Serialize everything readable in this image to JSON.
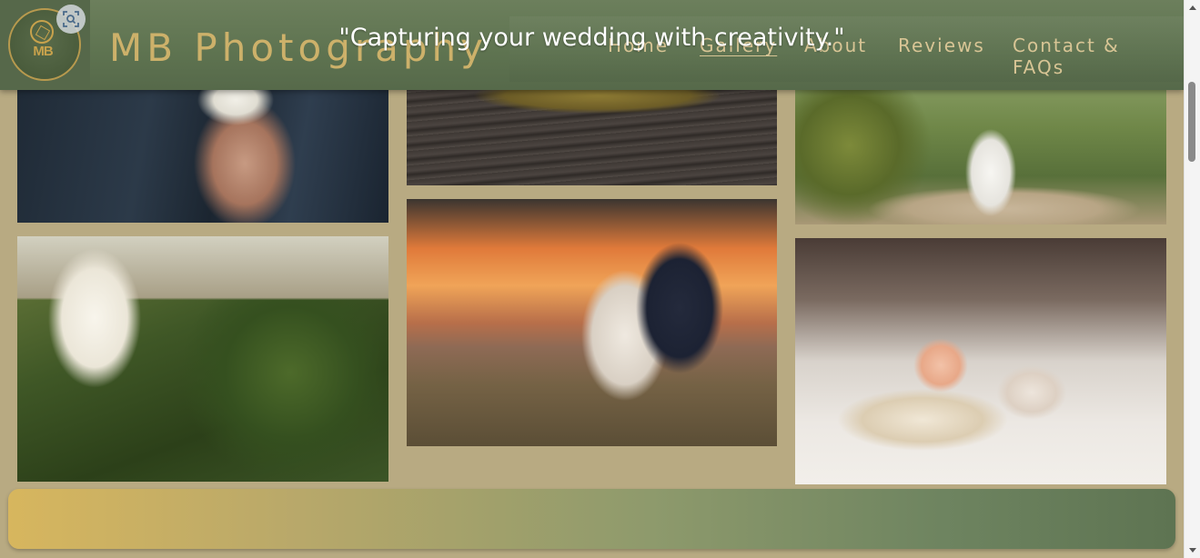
{
  "brand": {
    "logo_text": "MB",
    "title": "MB Photography"
  },
  "nav": {
    "items": [
      {
        "label": "Home",
        "active": false
      },
      {
        "label": "Gallery",
        "active": true
      },
      {
        "label": "About",
        "active": false
      },
      {
        "label": "Reviews",
        "active": false
      },
      {
        "label": "Contact & FAQs",
        "active": false
      }
    ]
  },
  "gallery": {
    "photos": [
      {
        "subject": "groom-boutonniere"
      },
      {
        "subject": "wedding-rings-on-wood"
      },
      {
        "subject": "couple-dancing-forest-path"
      },
      {
        "subject": "couple-sitting-on-dock"
      },
      {
        "subject": "couple-at-sunset-lake"
      },
      {
        "subject": "book-tea-and-flower"
      }
    ]
  },
  "footer": {
    "quote": "\"Capturing your wedding with creativity.\""
  },
  "icons": {
    "lens": "visual-search-icon"
  },
  "colors": {
    "header_bg": "#5e7350",
    "page_bg": "#b8aa82",
    "gold_text": "#cdb16a",
    "nav_text": "#d8c595"
  }
}
